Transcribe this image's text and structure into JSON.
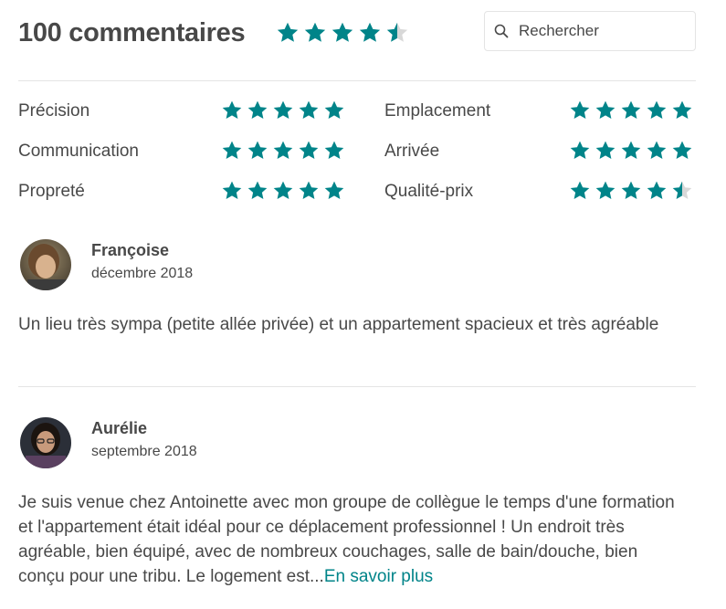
{
  "header": {
    "title": "100 commentaires",
    "overall_rating": 4.5,
    "search_placeholder": "Rechercher"
  },
  "categories": [
    {
      "label": "Précision",
      "rating": 5
    },
    {
      "label": "Emplacement",
      "rating": 5
    },
    {
      "label": "Communication",
      "rating": 5
    },
    {
      "label": "Arrivée",
      "rating": 5
    },
    {
      "label": "Propreté",
      "rating": 5
    },
    {
      "label": "Qualité-prix",
      "rating": 4.5
    }
  ],
  "reviews": [
    {
      "name": "Françoise",
      "date": "décembre 2018",
      "text": "Un lieu très sympa (petite allée privée) et un appartement spacieux et très agréable"
    },
    {
      "name": "Aurélie",
      "date": "septembre 2018",
      "text": "Je suis venue chez Antoinette avec mon groupe de collègue le temps d'une formation et l'appartement était idéal pour ce déplacement professionnel ! Un endroit très agréable, bien équipé, avec de nombreux couchages, salle de bain/douche, bien conçu pour une tribu. Le logement est...",
      "read_more": "En savoir plus"
    }
  ],
  "colors": {
    "star_fill": "#008489",
    "star_empty": "#d8d8d8",
    "text": "#484848",
    "link": "#008489"
  }
}
